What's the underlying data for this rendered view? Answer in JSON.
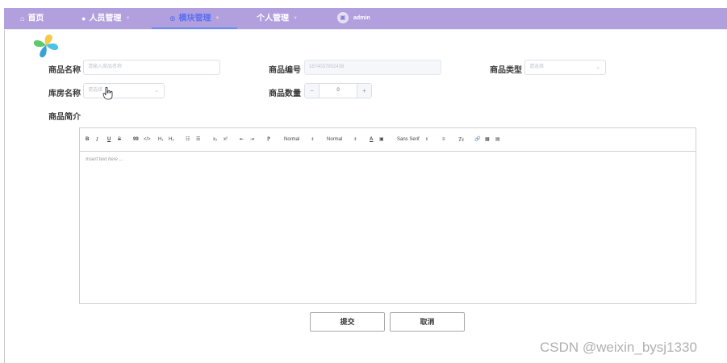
{
  "nav": {
    "items": [
      {
        "label": "首页",
        "icon": "home-icon"
      },
      {
        "label": "人员管理",
        "icon": "user-icon"
      },
      {
        "label": "模块管理",
        "icon": "module-icon",
        "active": true
      },
      {
        "label": "个人管理",
        "icon": ""
      }
    ],
    "user": "admin"
  },
  "form": {
    "name": {
      "label": "商品名称",
      "placeholder": "请输入商品名称"
    },
    "code": {
      "label": "商品编号",
      "value": "1674037802438"
    },
    "type": {
      "label": "商品类型",
      "placeholder": "请选择"
    },
    "warehouse": {
      "label": "库房名称",
      "placeholder": "请选择"
    },
    "quantity": {
      "label": "商品数量",
      "value": "0",
      "minus": "−",
      "plus": "+"
    },
    "intro": {
      "label": "商品简介"
    }
  },
  "editor": {
    "toolbar": {
      "bold": "B",
      "italic": "I",
      "underline": "U",
      "strike": "S",
      "quote": "99",
      "code": "</>",
      "h1": "H₁",
      "h2": "H₂",
      "ol": "☷",
      "ul": "☰",
      "sub": "x₂",
      "sup": "x²",
      "outdent": "⇤",
      "indent": "⇥",
      "rtl": "⁋",
      "size": "Normal",
      "header": "Normal",
      "color": "A",
      "background": "▣",
      "font": "Sans Serif",
      "align": "≡",
      "clean": "Tx",
      "link": "🔗",
      "image": "▦",
      "video": "▤"
    },
    "placeholder": "Insert text here ..."
  },
  "actions": {
    "submit": "提交",
    "cancel": "取消"
  },
  "watermark": "CSDN @weixin_bysj1330",
  "colors": {
    "nav_bg": "#b19fde",
    "active_nav": "#5a6ff0"
  }
}
